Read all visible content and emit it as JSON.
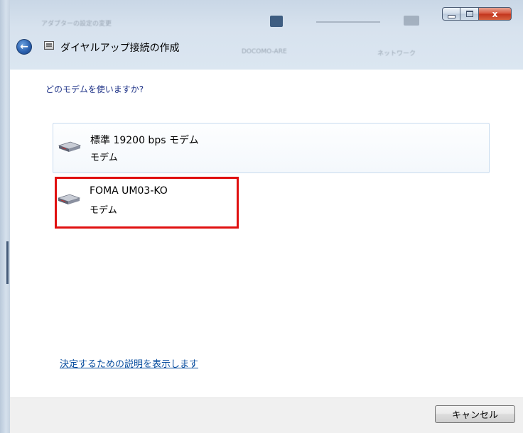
{
  "window": {
    "title": "ダイヤルアップ接続の作成",
    "caption_buttons": [
      "minimize",
      "maximize",
      "close"
    ],
    "close_glyph": "x"
  },
  "background_blur": {
    "text1": "アダプターの設定の変更",
    "text2": "DOCOMO-ARE",
    "text3": "ネットワーク"
  },
  "nav": {
    "back_glyph": "←"
  },
  "content": {
    "question": "どのモデムを使いますか?",
    "modems": [
      {
        "name": "標準 19200 bps モデム",
        "type": "モデム",
        "icon": "modem-icon"
      },
      {
        "name": "FOMA UM03-KO",
        "type": "モデム",
        "icon": "modem-icon"
      }
    ],
    "help_link": "決定するための説明を表示します"
  },
  "footer": {
    "cancel_label": "キャンセル"
  },
  "colors": {
    "highlight": "#e01010",
    "link": "#0b4fa0",
    "question_text": "#1e3287"
  }
}
